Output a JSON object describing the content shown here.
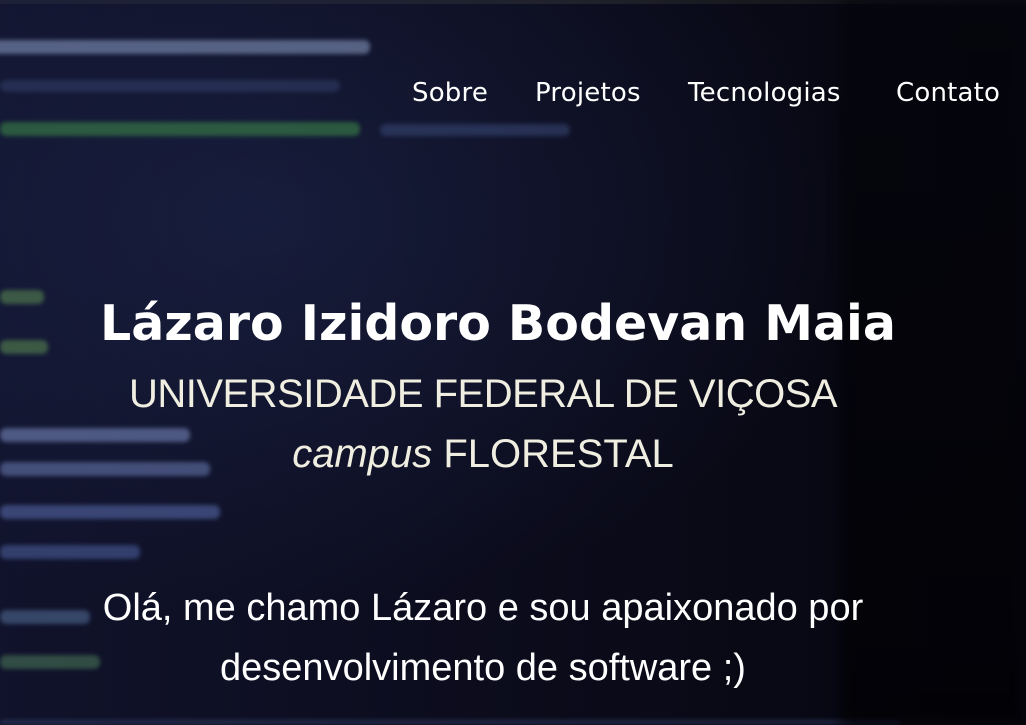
{
  "nav": {
    "items": [
      {
        "label": "Sobre"
      },
      {
        "label": "Projetos"
      },
      {
        "label": "Tecnologias"
      },
      {
        "label": "Contato"
      }
    ]
  },
  "hero": {
    "name": "Lázaro Izidoro Bodevan Maia",
    "university": "UNIVERSIDADE FEDERAL DE VIÇOSA",
    "campus_word": "campus",
    "campus_name": "FLORESTAL",
    "greeting_line1": "Olá, me chamo Lázaro e sou apaixonado por",
    "greeting_line2": "desenvolvimento de software ;)"
  },
  "colors": {
    "background": "#0b0b1a",
    "text": "#ffffff",
    "subtitle": "#f0eee0",
    "code_green": "#4caf50",
    "code_blue": "#5b7bd6"
  }
}
